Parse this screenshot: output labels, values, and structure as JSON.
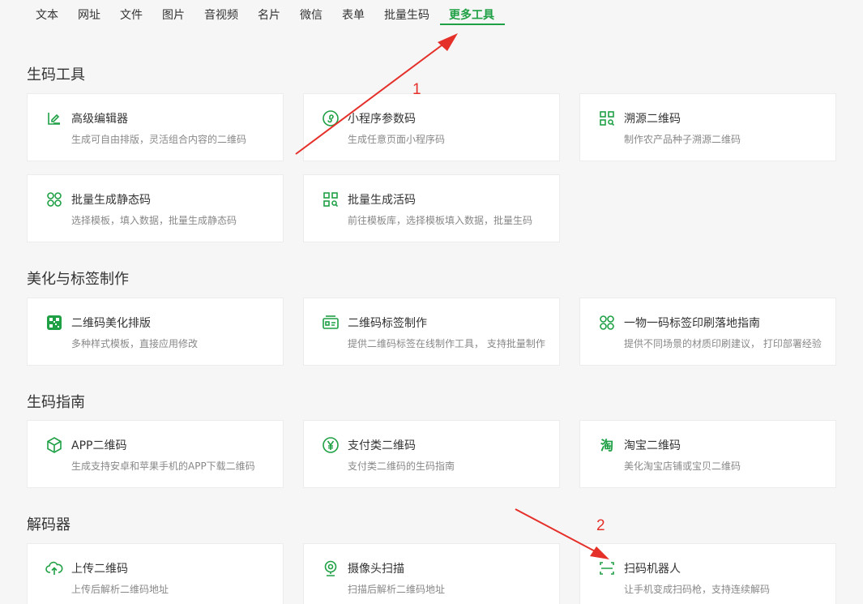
{
  "nav": {
    "tabs": [
      {
        "label": "文本"
      },
      {
        "label": "网址"
      },
      {
        "label": "文件"
      },
      {
        "label": "图片"
      },
      {
        "label": "音视频"
      },
      {
        "label": "名片"
      },
      {
        "label": "微信"
      },
      {
        "label": "表单"
      },
      {
        "label": "批量生码"
      },
      {
        "label": "更多工具"
      }
    ],
    "active": "更多工具"
  },
  "sections": [
    {
      "title": "生码工具",
      "cards": [
        {
          "title": "高级编辑器",
          "desc": "生成可自由排版，灵活组合内容的二维码",
          "icon": "edit-icon"
        },
        {
          "title": "小程序参数码",
          "desc": "生成任意页面小程序码",
          "icon": "miniprogram-icon"
        },
        {
          "title": "溯源二维码",
          "desc": "制作农产品种子溯源二维码",
          "icon": "qr-search-icon"
        },
        {
          "title": "批量生成静态码",
          "desc": "选择模板，填入数据，批量生成静态码",
          "icon": "clover-icon"
        },
        {
          "title": "批量生成活码",
          "desc": "前往模板库，选择模板填入数据，批量生码",
          "icon": "qr-search-icon"
        }
      ]
    },
    {
      "title": "美化与标签制作",
      "cards": [
        {
          "title": "二维码美化排版",
          "desc": "多种样式模板，直接应用修改",
          "icon": "qr-art-icon"
        },
        {
          "title": "二维码标签制作",
          "desc": "提供二维码标签在线制作工具， 支持批量制作",
          "icon": "label-icon"
        },
        {
          "title": "一物一码标签印刷落地指南",
          "desc": "提供不同场景的材质印刷建议， 打印部署经验",
          "icon": "clover-icon"
        }
      ]
    },
    {
      "title": "生码指南",
      "cards": [
        {
          "title": "APP二维码",
          "desc": "生成支持安卓和苹果手机的APP下载二维码",
          "icon": "cube-icon"
        },
        {
          "title": "支付类二维码",
          "desc": "支付类二维码的生码指南",
          "icon": "yen-icon"
        },
        {
          "title": "淘宝二维码",
          "desc": "美化淘宝店铺或宝贝二维码",
          "icon": "taobao-icon"
        }
      ]
    },
    {
      "title": "解码器",
      "cards": [
        {
          "title": "上传二维码",
          "desc": "上传后解析二维码地址",
          "icon": "cloud-upload-icon"
        },
        {
          "title": "摄像头扫描",
          "desc": "扫描后解析二维码地址",
          "icon": "webcam-icon"
        },
        {
          "title": "扫码机器人",
          "desc": "让手机变成扫码枪，支持连续解码",
          "icon": "scan-icon"
        }
      ]
    }
  ],
  "annotations": {
    "arrow1_label": "1",
    "arrow2_label": "2",
    "color": "#e5302a"
  },
  "colors": {
    "accent": "#1fa045",
    "background": "#f6f6f6"
  }
}
